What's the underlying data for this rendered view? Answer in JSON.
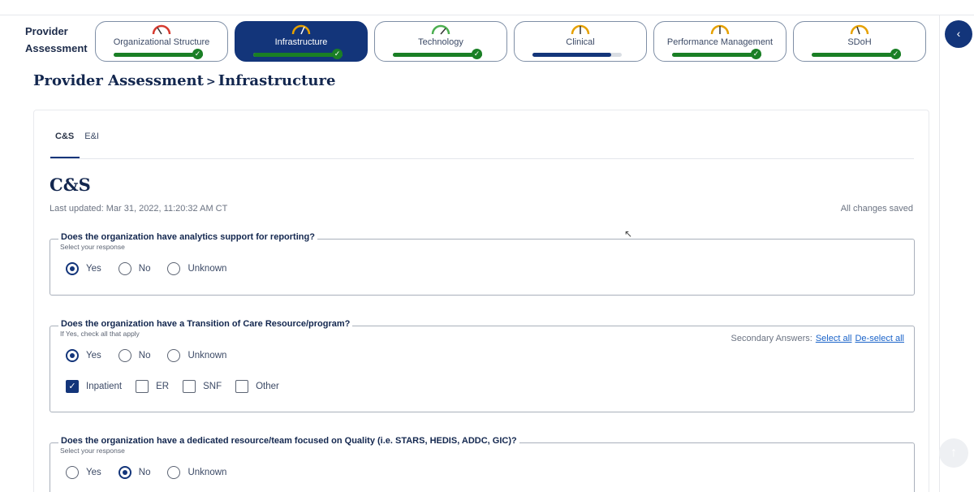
{
  "header": {
    "label_line1": "Provider",
    "label_line2": "Assessment"
  },
  "steps": [
    {
      "label": "Organizational Structure",
      "progress": 1.0,
      "complete": true,
      "active": false,
      "gauge_color": "#d63a2f"
    },
    {
      "label": "Infrastructure",
      "progress": 1.0,
      "complete": true,
      "active": true,
      "gauge_color": "#e6a100"
    },
    {
      "label": "Technology",
      "progress": 1.0,
      "complete": true,
      "active": false,
      "gauge_color": "#4caf50"
    },
    {
      "label": "Clinical",
      "progress": 0.8,
      "complete": false,
      "active": false,
      "gauge_color": "#e6a100"
    },
    {
      "label": "Performance Management",
      "progress": 1.0,
      "complete": true,
      "active": false,
      "gauge_color": "#e6a100"
    },
    {
      "label": "SDoH",
      "progress": 1.0,
      "complete": true,
      "active": false,
      "gauge_color": "#e6a100"
    }
  ],
  "breadcrumb": {
    "root": "Provider Assessment",
    "sep": ">",
    "current": "Infrastructure"
  },
  "subtabs": [
    {
      "label": "C&S",
      "selected": true
    },
    {
      "label": "E&I",
      "selected": false
    }
  ],
  "section": {
    "title": "C&S",
    "last_updated": "Last updated: Mar 31, 2022, 11:20:32 AM CT",
    "saved_status": "All changes saved"
  },
  "questions": [
    {
      "title": "Does the organization have analytics support for reporting?",
      "hint": "Select your response",
      "options": [
        {
          "label": "Yes",
          "selected": true
        },
        {
          "label": "No",
          "selected": false
        },
        {
          "label": "Unknown",
          "selected": false
        }
      ]
    },
    {
      "title": "Does the organization have a Transition of Care Resource/program?",
      "hint": "If Yes, check all that apply",
      "options": [
        {
          "label": "Yes",
          "selected": true
        },
        {
          "label": "No",
          "selected": false
        },
        {
          "label": "Unknown",
          "selected": false
        }
      ],
      "secondary_label": "Secondary Answers:",
      "select_all": "Select all",
      "deselect_all": "De-select all",
      "checkboxes": [
        {
          "label": "Inpatient",
          "checked": true
        },
        {
          "label": "ER",
          "checked": false
        },
        {
          "label": "SNF",
          "checked": false
        },
        {
          "label": "Other",
          "checked": false
        }
      ]
    },
    {
      "title": "Does the organization have a dedicated resource/team focused on Quality (i.e. STARS, HEDIS, ADDC, GIC)?",
      "hint": "Select your response",
      "options": [
        {
          "label": "Yes",
          "selected": false
        },
        {
          "label": "No",
          "selected": true
        },
        {
          "label": "Unknown",
          "selected": false
        }
      ]
    }
  ],
  "icons": {
    "collapse": "chevron-left-icon",
    "check": "check-icon",
    "gauge": "gauge-icon",
    "scroll_top": "arrow-up-icon"
  }
}
